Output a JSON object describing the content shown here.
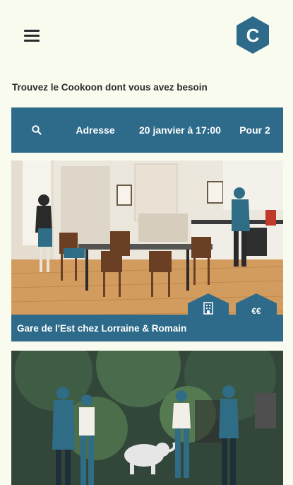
{
  "header": {
    "menu_icon": "hamburger-menu-icon",
    "logo_letter": "C",
    "logo_color": "#2e6b8a"
  },
  "tagline": "Trouvez le Cookoon dont vous avez besoin",
  "search": {
    "icon": "search-icon",
    "address_label": "Adresse",
    "date_label": "20 janvier à 17:00",
    "guests_label": "Pour 2",
    "background": "#2e6b8a"
  },
  "listings": [
    {
      "title": "Gare de l'Est chez Lorraine & Romain",
      "badge_icon": "building-icon",
      "price_label": "€€"
    },
    {
      "title": ""
    }
  ],
  "colors": {
    "page_background": "#fafbef",
    "accent": "#2e6b8a"
  }
}
